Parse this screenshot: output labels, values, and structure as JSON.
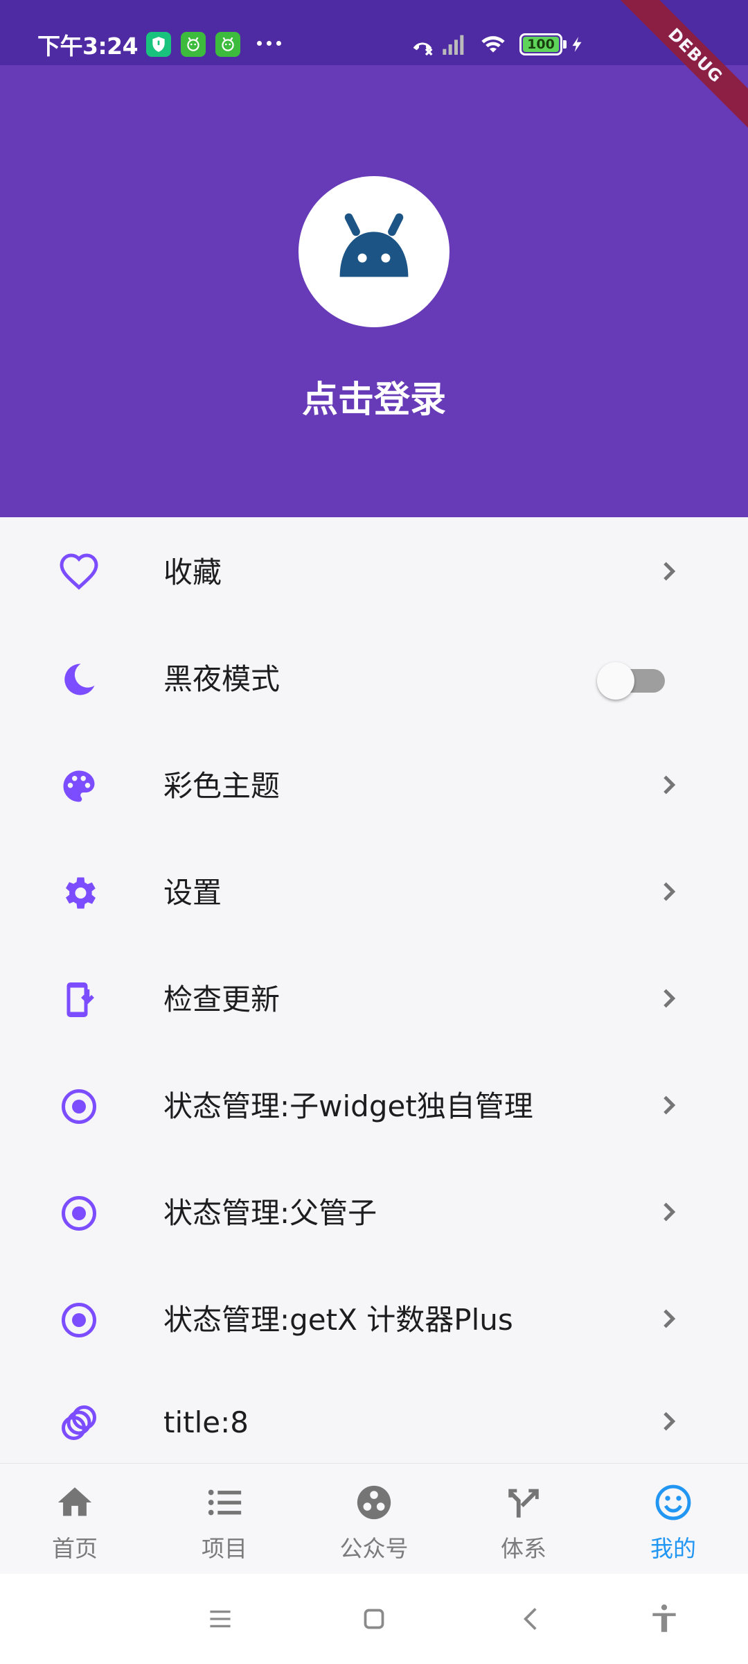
{
  "status_bar": {
    "time": "下午3:24",
    "battery_level": "100",
    "notification_icons": [
      "shield-icon",
      "android-app-icon",
      "android-app-icon"
    ]
  },
  "debug_banner": "DEBUG",
  "profile": {
    "login_text": "点击登录",
    "avatar_icon": "android-icon"
  },
  "menu": [
    {
      "label": "收藏",
      "icon": "heart-outline-icon",
      "control": "chevron"
    },
    {
      "label": "黑夜模式",
      "icon": "moon-icon",
      "control": "switch",
      "switch_on": false
    },
    {
      "label": "彩色主题",
      "icon": "palette-icon",
      "control": "chevron"
    },
    {
      "label": "设置",
      "icon": "gear-icon",
      "control": "chevron"
    },
    {
      "label": "检查更新",
      "icon": "phone-download-icon",
      "control": "chevron"
    },
    {
      "label": "状态管理:子widget独自管理",
      "icon": "radio-button-icon",
      "control": "chevron"
    },
    {
      "label": "状态管理:父管子",
      "icon": "radio-button-icon",
      "control": "chevron"
    },
    {
      "label": "状态管理:getX 计数器Plus",
      "icon": "radio-button-icon",
      "control": "chevron"
    },
    {
      "label": "title:8",
      "icon": "circles-icon",
      "control": "chevron"
    }
  ],
  "bottom_nav": [
    {
      "label": "首页",
      "icon": "home-icon",
      "active": false
    },
    {
      "label": "项目",
      "icon": "list-icon",
      "active": false
    },
    {
      "label": "公众号",
      "icon": "group-icon",
      "active": false
    },
    {
      "label": "体系",
      "icon": "merge-icon",
      "active": false
    },
    {
      "label": "我的",
      "icon": "smiley-icon",
      "active": true
    }
  ],
  "colors": {
    "header": "#673ab7",
    "status_bar": "#4f2ba3",
    "icon_accent": "#7c4dff",
    "active_tab": "#2196f3",
    "inactive_tab": "#757575"
  }
}
